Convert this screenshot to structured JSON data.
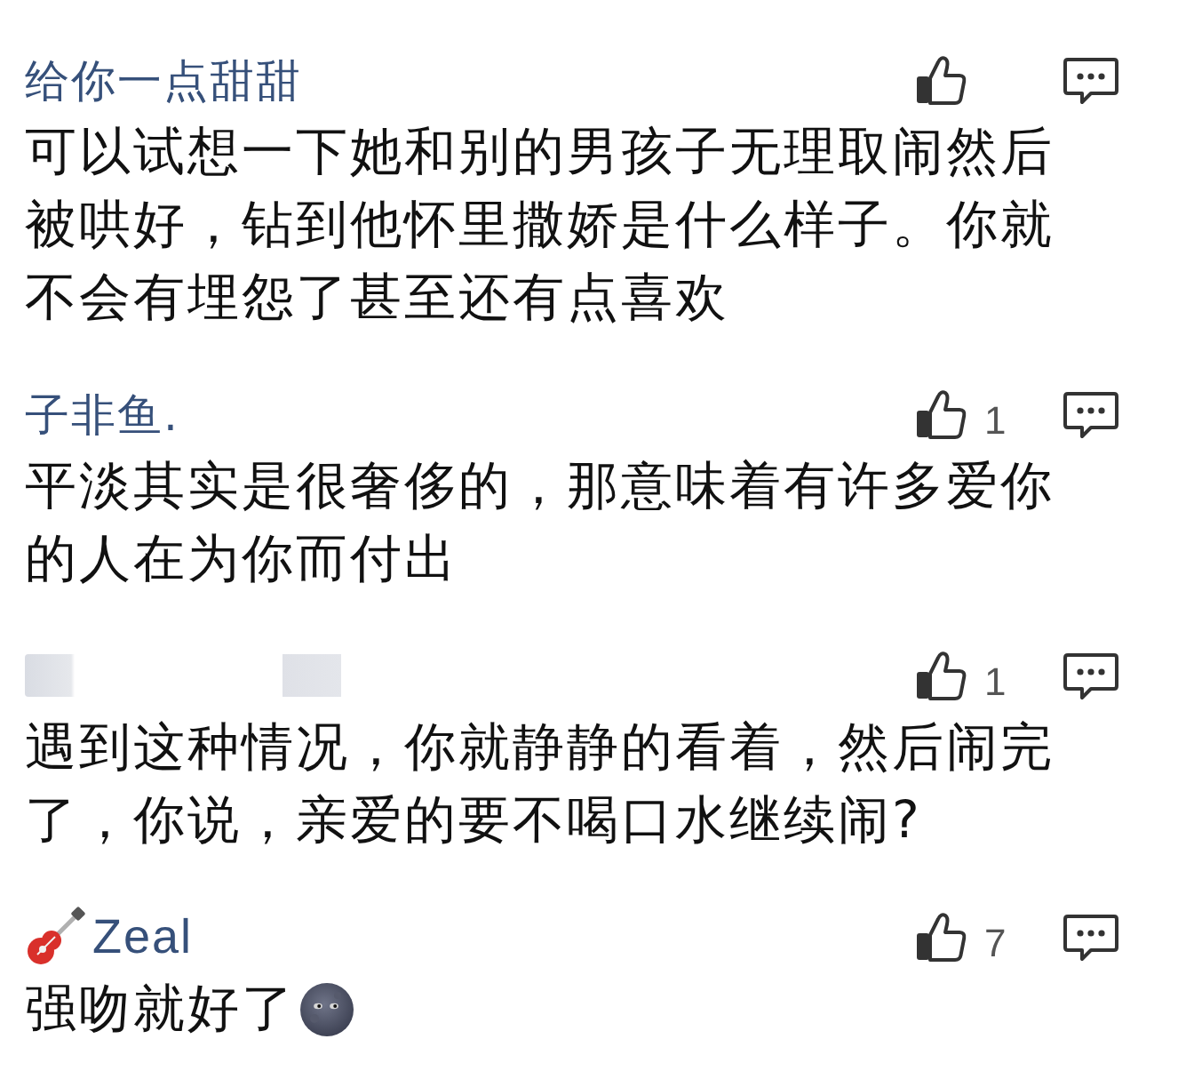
{
  "comments": [
    {
      "author": {
        "kind": "plain",
        "name": "给你一点甜甜"
      },
      "body": "可以试想一下她和别的男孩子无理取闹然后被哄好，钻到他怀里撒娇是什么样子。你就不会有埋怨了甚至还有点喜欢"
    },
    {
      "author": {
        "kind": "plain",
        "name": "子非鱼."
      },
      "likes": "1",
      "body": "平淡其实是很奢侈的，那意味着有许多爱你的人在为你而付出"
    },
    {
      "author": {
        "kind": "redacted"
      },
      "likes": "1",
      "body": "遇到这种情况，你就静静的看着，然后闹完了，你说，亲爱的要不喝口水继续闹?"
    },
    {
      "author": {
        "kind": "icon_prefixed",
        "name": "Zeal"
      },
      "likes": "7",
      "body": "强吻就好了",
      "trailing_icon": true
    }
  ]
}
